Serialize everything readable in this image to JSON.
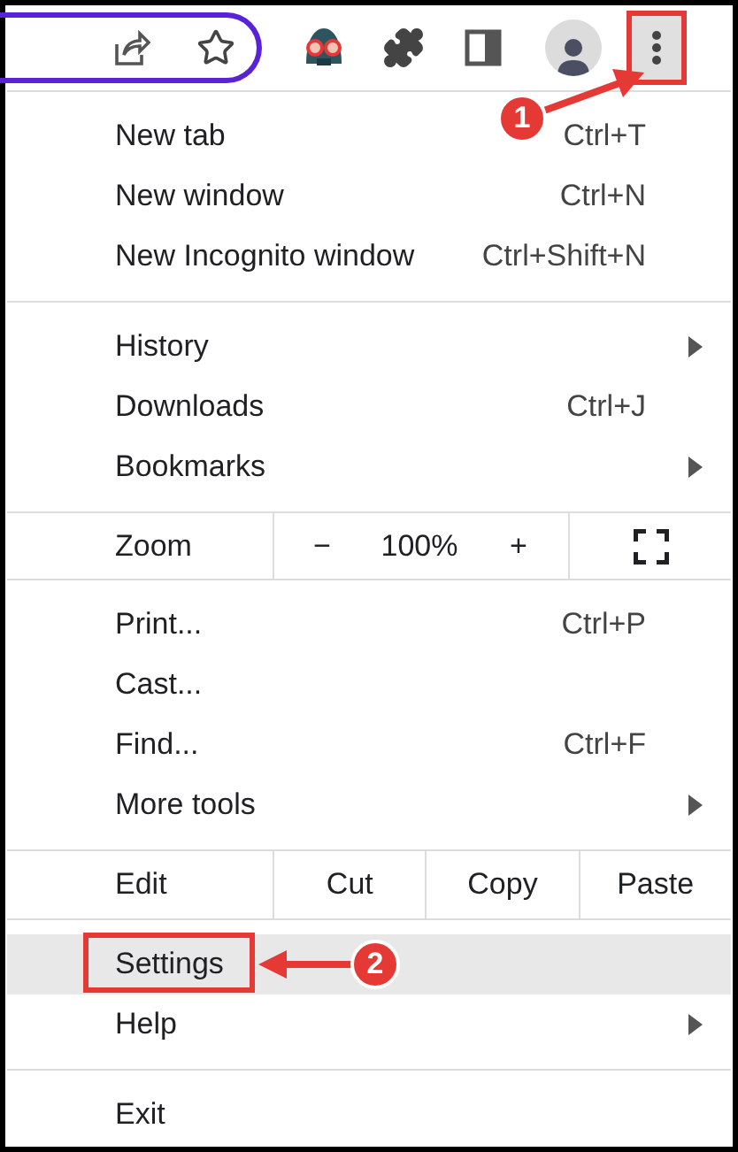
{
  "toolbar": {
    "menu_button": {
      "annotation": "1"
    }
  },
  "menu": {
    "sections": [
      {
        "kind": "items",
        "items": [
          {
            "label": "New tab",
            "shortcut": "Ctrl+T",
            "submenu": false,
            "selected": false
          },
          {
            "label": "New window",
            "shortcut": "Ctrl+N",
            "submenu": false,
            "selected": false
          },
          {
            "label": "New Incognito window",
            "shortcut": "Ctrl+Shift+N",
            "submenu": false,
            "selected": false
          }
        ]
      },
      {
        "kind": "items",
        "items": [
          {
            "label": "History",
            "submenu": true,
            "selected": false
          },
          {
            "label": "Downloads",
            "shortcut": "Ctrl+J",
            "submenu": false,
            "selected": false
          },
          {
            "label": "Bookmarks",
            "submenu": true,
            "selected": false
          }
        ]
      },
      {
        "kind": "zoom",
        "label": "Zoom",
        "minus": "−",
        "value": "100%",
        "plus": "+"
      },
      {
        "kind": "items",
        "items": [
          {
            "label": "Print...",
            "shortcut": "Ctrl+P",
            "submenu": false,
            "selected": false
          },
          {
            "label": "Cast...",
            "submenu": false,
            "selected": false
          },
          {
            "label": "Find...",
            "shortcut": "Ctrl+F",
            "submenu": false,
            "selected": false
          },
          {
            "label": "More tools",
            "submenu": true,
            "selected": false
          }
        ]
      },
      {
        "kind": "edit",
        "label": "Edit",
        "buttons": [
          "Cut",
          "Copy",
          "Paste"
        ]
      },
      {
        "kind": "items",
        "items": [
          {
            "label": "Settings",
            "submenu": false,
            "selected": true,
            "annotation": "2"
          },
          {
            "label": "Help",
            "submenu": true,
            "selected": false
          }
        ]
      },
      {
        "kind": "items",
        "items": [
          {
            "label": "Exit",
            "submenu": false,
            "selected": false
          }
        ]
      }
    ]
  }
}
